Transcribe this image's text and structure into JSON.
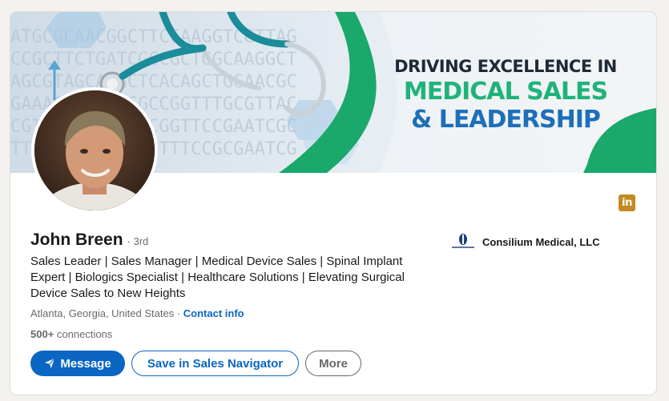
{
  "banner": {
    "line1": "DRIVING EXCELLENCE IN",
    "line2": "MEDICAL SALES",
    "line3": "& LEADERSHIP"
  },
  "profile": {
    "name": "John Breen",
    "degree": "· 3rd",
    "headline": "Sales Leader | Sales Manager | Medical Device Sales | Spinal Implant Expert | Biologics Specialist | Healthcare Solutions | Elevating Surgical Device Sales to New Heights",
    "location": "Atlanta, Georgia, United States",
    "location_sep": " · ",
    "contact_info": "Contact info",
    "connections_count": "500+",
    "connections_label": " connections"
  },
  "company": {
    "name": "Consilium Medical, LLC"
  },
  "linkedin_badge": "in",
  "actions": {
    "message": "Message",
    "save": "Save in Sales Navigator",
    "more": "More"
  },
  "colors": {
    "primary": "#0a66c2",
    "banner_green": "#1fb37a",
    "banner_blue": "#1d6fb8",
    "badge": "#c28a20"
  },
  "icons": {
    "message_icon": "send-icon",
    "linkedin_icon": "linkedin-icon",
    "company_logo": "company-logo"
  }
}
